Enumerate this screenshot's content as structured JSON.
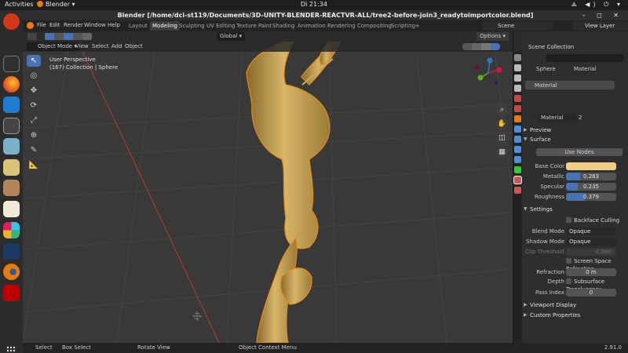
{
  "os": {
    "activities": "Activities",
    "app_name": "Blender",
    "clock": "Di 21:34",
    "system_icons": "⟁ ◀) ⏻ ▾"
  },
  "window": {
    "title": "Blender [/home/dci-st119/Documents/3D-UNITY-BLENDER-REACTVR-ALL/tree2-before-join3_readytoimportcolor.blend]",
    "controls": "– ◻ ✕"
  },
  "header": {
    "menus": [
      "File",
      "Edit",
      "Render",
      "Window",
      "Help"
    ],
    "workspaces": [
      "Layout",
      "Modeling",
      "Sculpting",
      "UV Editing",
      "Texture Paint",
      "Shading",
      "Animation",
      "Rendering",
      "Compositing",
      "Scripting"
    ],
    "active_workspace": "Modeling",
    "scene": "Scene",
    "view_layer": "View Layer"
  },
  "tool_header": {
    "orientation": "Global",
    "options": "Options"
  },
  "viewport": {
    "mode": "Object Mode",
    "menus": [
      "View",
      "Select",
      "Add",
      "Object"
    ],
    "info_line1": "User Perspective",
    "info_line2": "(167) Collection | Sphere"
  },
  "properties": {
    "object_name": "Sphere",
    "material_tab": "Material",
    "slot_name": "Material",
    "material_name": "Material",
    "users": "2",
    "sections": {
      "preview": "Preview",
      "surface": "Surface",
      "settings": "Settings",
      "viewport_display": "Viewport Display",
      "custom_properties": "Custom Properties"
    },
    "use_nodes": "Use Nodes",
    "base_color_label": "Base Color",
    "base_color": "#f0cf85",
    "metallic_label": "Metallic",
    "metallic": "0.283",
    "metallic_fraction": 0.283,
    "specular_label": "Specular",
    "specular": "0.235",
    "specular_fraction": 0.235,
    "roughness_label": "Roughness",
    "roughness": "0.379",
    "roughness_fraction": 0.379,
    "backface_culling": "Backface Culling",
    "blend_mode_label": "Blend Mode",
    "blend_mode": "Opaque",
    "shadow_mode_label": "Shadow Mode",
    "shadow_mode": "Opaque",
    "clip_threshold_label": "Clip Threshold",
    "clip_threshold": "0.000",
    "screen_space_refraction": "Screen Space Refraction",
    "refraction_depth_label": "Refraction Depth",
    "refraction_depth": "0 m",
    "subsurface_translucency": "Subsurface Translucency",
    "pass_index_label": "Pass Index",
    "pass_index": "0",
    "outliner_title": "Scene Collection"
  },
  "status": {
    "select": "Select",
    "box_select": "Box Select",
    "rotate_view": "Rotate View",
    "context_menu": "Object Context Menu",
    "version": "2.91.0"
  },
  "colors": {
    "accent": "#4772b3",
    "object_gold": "#c9a85a",
    "selection_outline": "#e88a1a"
  }
}
